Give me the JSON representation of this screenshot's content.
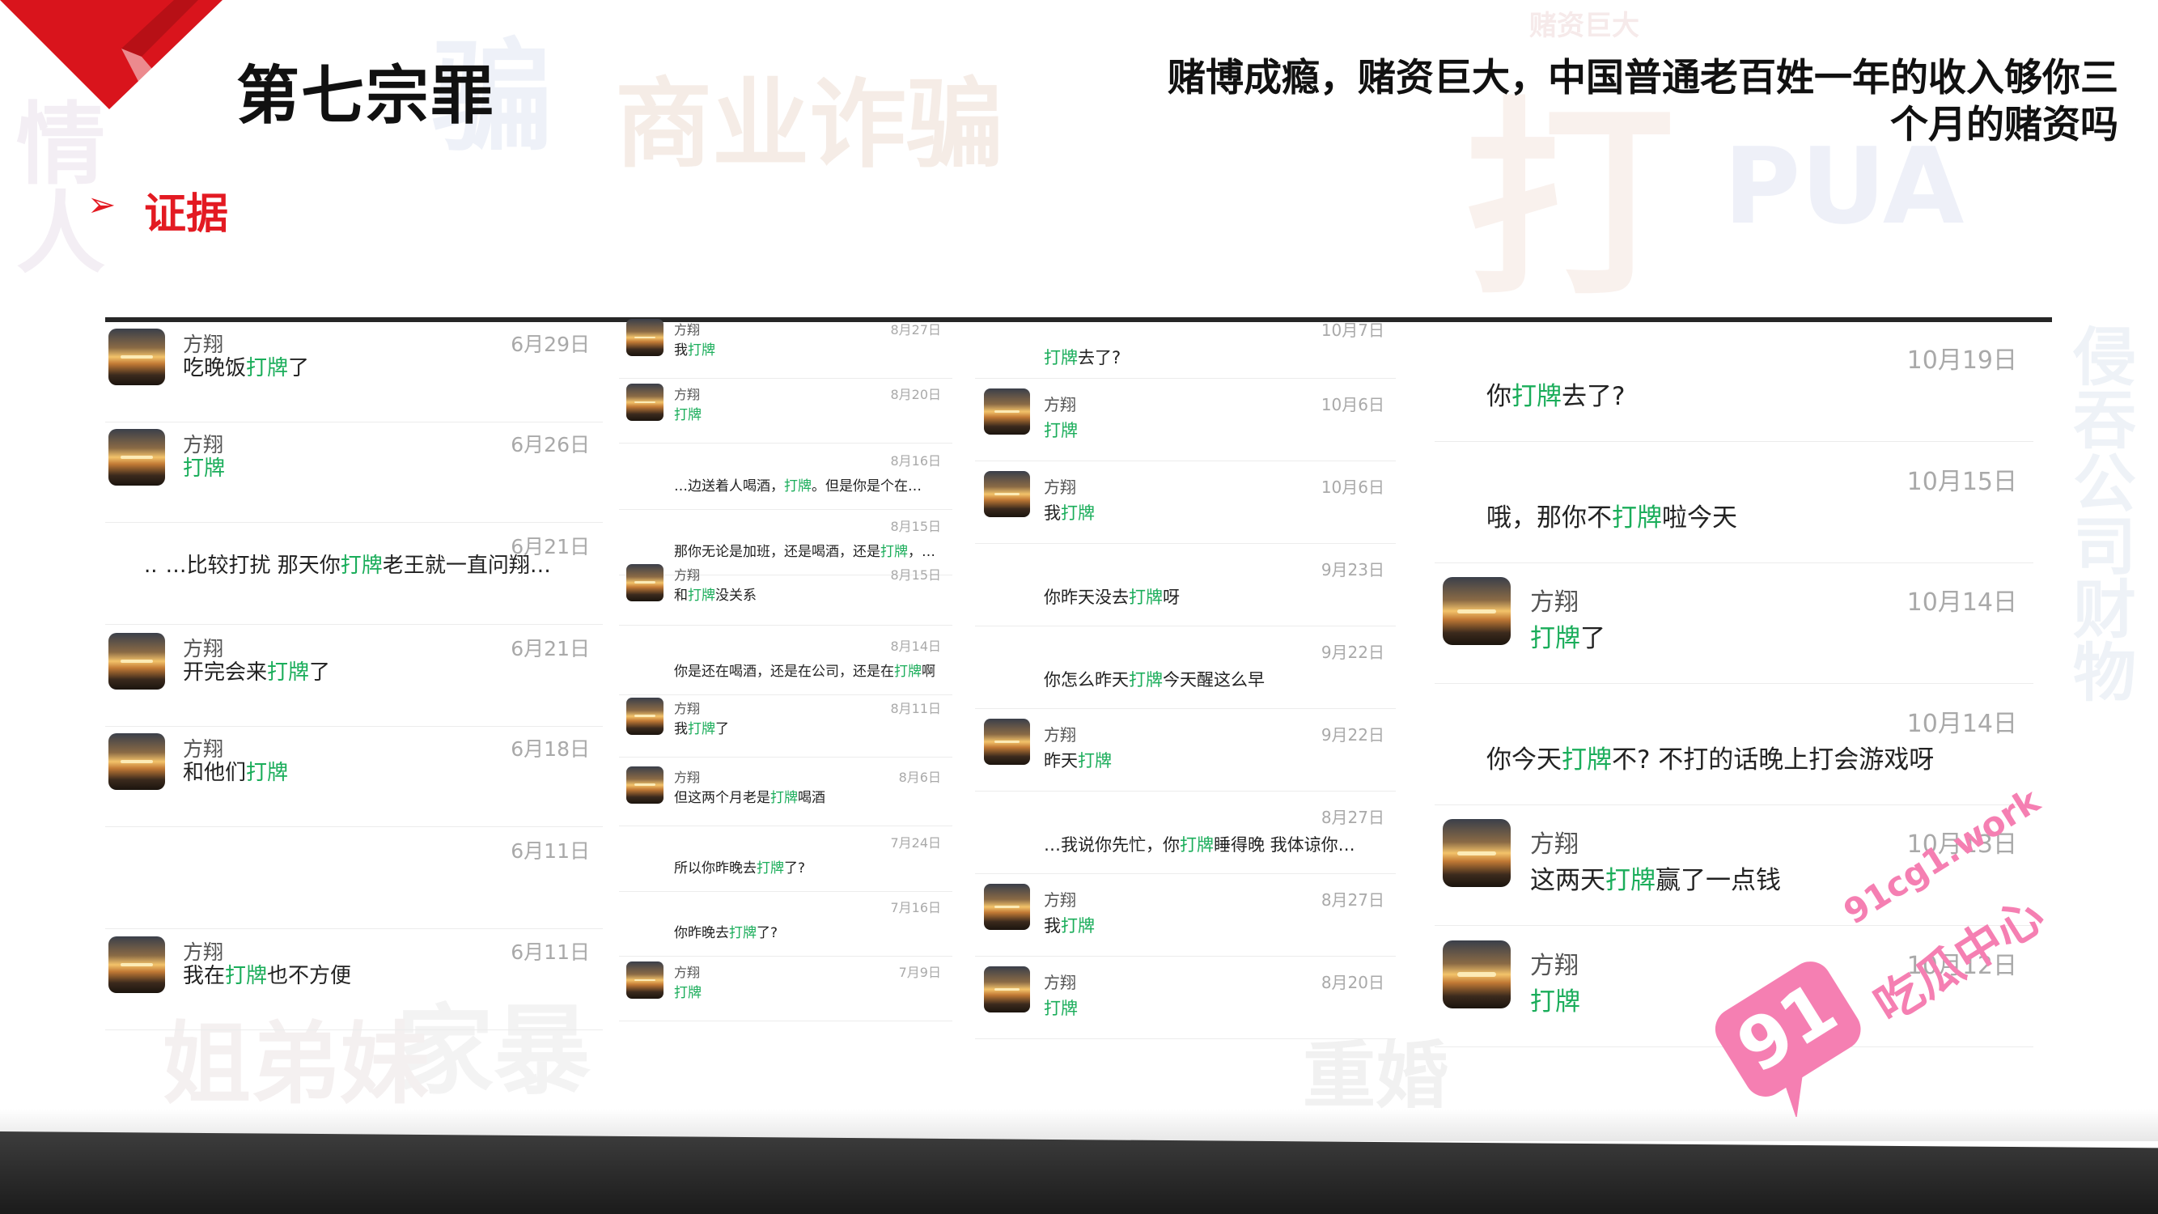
{
  "header": {
    "title": "第七宗罪",
    "subtitle_line1": "赌博成瘾，赌资巨大，中国普通老百姓一年的收入够你三",
    "subtitle_line2": "个月的赌资吗"
  },
  "section": {
    "bullet": "➢",
    "label": "证据"
  },
  "background_words": [
    "商业诈骗",
    "家暴",
    "PUA",
    "重婚",
    "侵吞公司财物",
    "赌资巨大",
    "姐弟妹",
    "打",
    "骗",
    "情人"
  ],
  "colors": {
    "accent_red": "#e31a22",
    "keyword_green": "#1aad5a",
    "watermark_pink": "#f57fb2"
  },
  "keyword": "打牌",
  "chat": {
    "col1": [
      {
        "sender": "方翔",
        "date": "6月29日",
        "pre": "吃晚饭",
        "kw": "打牌",
        "post": "了"
      },
      {
        "sender": "方翔",
        "date": "6月26日",
        "pre": "",
        "kw": "打牌",
        "post": ""
      },
      {
        "sender": "",
        "date": "6月21日",
        "pre": "…比较打扰 那天你",
        "kw": "打牌",
        "post": "老王就一直问翔…",
        "dots": ".."
      },
      {
        "sender": "方翔",
        "date": "6月21日",
        "pre": "开完会来",
        "kw": "打牌",
        "post": "了"
      },
      {
        "sender": "方翔",
        "date": "6月18日",
        "pre": "和他们",
        "kw": "打牌",
        "post": ""
      },
      {
        "sender": "",
        "date": "6月11日",
        "pre": "",
        "kw": "",
        "post": ""
      },
      {
        "sender": "方翔",
        "date": "6月11日",
        "pre": "我在",
        "kw": "打牌",
        "post": "也不方便"
      }
    ],
    "col2": [
      {
        "sender": "方翔",
        "date": "8月27日",
        "pre": "我",
        "kw": "打牌",
        "post": ""
      },
      {
        "sender": "方翔",
        "date": "8月20日",
        "pre": "",
        "kw": "打牌",
        "post": ""
      },
      {
        "sender": "",
        "date": "8月16日",
        "pre": "…边送着人喝酒，",
        "kw": "打牌",
        "post": "。但是你是个在…"
      },
      {
        "sender": "",
        "date": "8月15日",
        "pre": "那你无论是加班，还是喝酒，还是",
        "kw": "打牌",
        "post": "，…"
      },
      {
        "sender": "方翔",
        "date": "8月15日",
        "pre": "和",
        "kw": "打牌",
        "post": "没关系"
      },
      {
        "sender": "",
        "date": "8月14日",
        "pre": "你是还在喝酒，还是在公司，还是在",
        "kw": "打牌",
        "post": "啊"
      },
      {
        "sender": "方翔",
        "date": "8月11日",
        "pre": "我",
        "kw": "打牌",
        "post": "了"
      },
      {
        "sender": "方翔",
        "date": "8月6日",
        "pre": "但这两个月老是",
        "kw": "打牌",
        "post": "喝酒"
      },
      {
        "sender": "",
        "date": "7月24日",
        "pre": "所以你昨晚去",
        "kw": "打牌",
        "post": "了?"
      },
      {
        "sender": "",
        "date": "7月16日",
        "pre": "你昨晚去",
        "kw": "打牌",
        "post": "了?"
      },
      {
        "sender": "方翔",
        "date": "7月9日",
        "pre": "",
        "kw": "打牌",
        "post": ""
      }
    ],
    "col3": [
      {
        "sender": "",
        "date": "10月7日",
        "pre": "",
        "kw": "打牌",
        "post": "去了?"
      },
      {
        "sender": "方翔",
        "date": "10月6日",
        "pre": "",
        "kw": "打牌",
        "post": ""
      },
      {
        "sender": "方翔",
        "date": "10月6日",
        "pre": "我",
        "kw": "打牌",
        "post": ""
      },
      {
        "sender": "",
        "date": "9月23日",
        "pre": "你昨天没去",
        "kw": "打牌",
        "post": "呀"
      },
      {
        "sender": "",
        "date": "9月22日",
        "pre": "你怎么昨天",
        "kw": "打牌",
        "post": "今天醒这么早"
      },
      {
        "sender": "方翔",
        "date": "9月22日",
        "pre": "昨天",
        "kw": "打牌",
        "post": ""
      },
      {
        "sender": "",
        "date": "8月27日",
        "pre": "…我说你先忙，你",
        "kw": "打牌",
        "post": "睡得晚 我体谅你…"
      },
      {
        "sender": "方翔",
        "date": "8月27日",
        "pre": "我",
        "kw": "打牌",
        "post": ""
      },
      {
        "sender": "方翔",
        "date": "8月20日",
        "pre": "",
        "kw": "打牌",
        "post": ""
      }
    ],
    "col4": [
      {
        "sender": "",
        "date": "10月19日",
        "pre": "你",
        "kw": "打牌",
        "post": "去了?"
      },
      {
        "sender": "",
        "date": "10月15日",
        "pre": "哦，那你不",
        "kw": "打牌",
        "post": "啦今天"
      },
      {
        "sender": "方翔",
        "date": "10月14日",
        "pre": "",
        "kw": "打牌",
        "post": "了"
      },
      {
        "sender": "",
        "date": "10月14日",
        "pre": "你今天",
        "kw": "打牌",
        "post": "不? 不打的话晚上打会游戏呀"
      },
      {
        "sender": "方翔",
        "date": "10月13日",
        "pre": "这两天",
        "kw": "打牌",
        "post": "赢了一点钱"
      },
      {
        "sender": "方翔",
        "date": "10月12日",
        "pre": "",
        "kw": "打牌",
        "post": ""
      }
    ]
  },
  "watermark": {
    "number": "91",
    "url": "91cg1.work",
    "name": "吃瓜中心"
  }
}
